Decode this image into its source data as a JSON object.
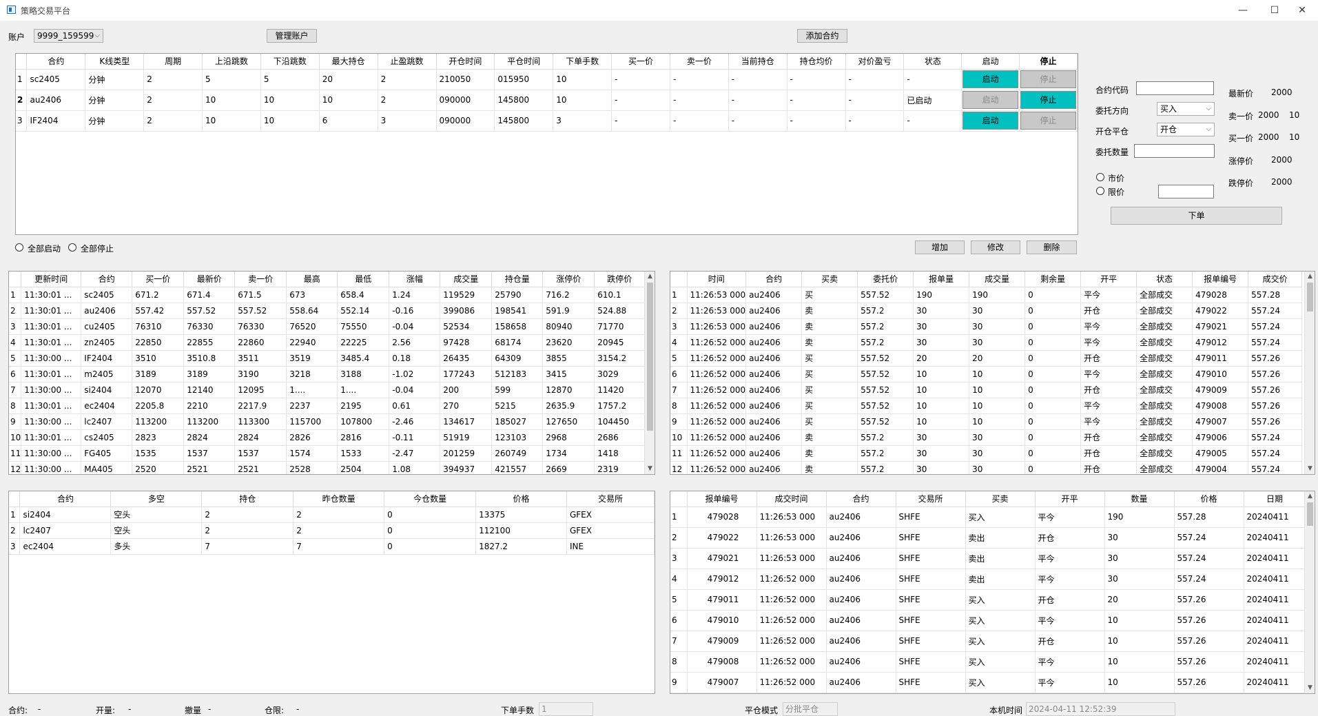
{
  "window": {
    "title": "策略交易平台",
    "min": "—",
    "max": "☐",
    "close": "✕"
  },
  "toolbar": {
    "account_label": "账户",
    "account_value": "9999_159599",
    "manage_btn": "管理账户",
    "add_contract_btn": "添加合约"
  },
  "strategy": {
    "headers": [
      "",
      "合约",
      "K线类型",
      "周期",
      "上沿跳数",
      "下沿跳数",
      "最大持仓",
      "止盈跳数",
      "开仓时间",
      "平仓时间",
      "下单手数",
      "买一价",
      "卖一价",
      "当前持仓",
      "持仓均价",
      "对价盈亏",
      "状态",
      "启动",
      "停止"
    ],
    "rows": [
      {
        "n": "1",
        "bold": false,
        "cells": [
          "sc2405",
          "分钟",
          "2",
          "5",
          "5",
          "20",
          "2",
          "210050",
          "015950",
          "10",
          "-",
          "-",
          "-",
          "-",
          "-",
          "-"
        ],
        "start": "启动",
        "stop": "停止",
        "start_on": true,
        "stop_on": false
      },
      {
        "n": "2",
        "bold": true,
        "cells": [
          "au2406",
          "分钟",
          "2",
          "10",
          "10",
          "10",
          "2",
          "090000",
          "145800",
          "10",
          "-",
          "-",
          "-",
          "-",
          "-",
          "已启动"
        ],
        "start": "启动",
        "stop": "停止",
        "start_on": false,
        "stop_on": true
      },
      {
        "n": "3",
        "bold": false,
        "cells": [
          "IF2404",
          "分钟",
          "2",
          "10",
          "10",
          "6",
          "3",
          "090000",
          "145800",
          "3",
          "-",
          "-",
          "-",
          "-",
          "-",
          "-"
        ],
        "start": "启动",
        "stop": "停止",
        "start_on": true,
        "stop_on": false
      }
    ],
    "all_start": "全部启动",
    "all_stop": "全部停止",
    "add_btn": "增加",
    "edit_btn": "修改",
    "delete_btn": "删除"
  },
  "order_form": {
    "code_label": "合约代码",
    "code_value": "",
    "direction_label": "委托方向",
    "direction_value": "买入",
    "offset_label": "开仓平仓",
    "offset_value": "开仓",
    "qty_label": "委托数量",
    "qty_value": "",
    "market_label": "市价",
    "limit_label": "限价",
    "limit_value": "",
    "submit_btn": "下单"
  },
  "quote_side": [
    {
      "label": "最新价",
      "value": "2000",
      "extra": ""
    },
    {
      "label": "卖一价",
      "value": "2000",
      "extra": "10"
    },
    {
      "label": "买一价",
      "value": "2000",
      "extra": "10"
    },
    {
      "label": "涨停价",
      "value": "2000",
      "extra": ""
    },
    {
      "label": "跌停价",
      "value": "2000",
      "extra": ""
    }
  ],
  "market": {
    "headers": [
      "",
      "更新时间",
      "合约",
      "买一价",
      "最新价",
      "卖一价",
      "最高",
      "最低",
      "涨幅",
      "成交量",
      "持仓量",
      "涨停价",
      "跌停价"
    ],
    "rows": [
      [
        "1",
        "11:30:01 ...",
        "sc2405",
        "671.2",
        "671.4",
        "671.5",
        "673",
        "658.4",
        "1.24",
        "119529",
        "25790",
        "716.2",
        "610.1"
      ],
      [
        "2",
        "11:30:01 ...",
        "au2406",
        "557.42",
        "557.52",
        "557.52",
        "558.64",
        "552.14",
        "-0.16",
        "399086",
        "198541",
        "591.9",
        "524.88"
      ],
      [
        "3",
        "11:30:01 ...",
        "cu2405",
        "76310",
        "76330",
        "76330",
        "76520",
        "75550",
        "-0.04",
        "52534",
        "158658",
        "80940",
        "71770"
      ],
      [
        "4",
        "11:30:01 ...",
        "zn2405",
        "22850",
        "22855",
        "22860",
        "22940",
        "22225",
        "2.56",
        "97428",
        "68174",
        "23620",
        "20945"
      ],
      [
        "5",
        "11:30:00 ...",
        "IF2404",
        "3510",
        "3510.8",
        "3511",
        "3519",
        "3485.4",
        "0.18",
        "26435",
        "64309",
        "3855",
        "3154.2"
      ],
      [
        "6",
        "11:30:01 ...",
        "m2405",
        "3189",
        "3189",
        "3190",
        "3218",
        "3188",
        "-1.02",
        "177243",
        "512183",
        "3415",
        "3029"
      ],
      [
        "7",
        "11:30:00 ...",
        "si2404",
        "12070",
        "12140",
        "12095",
        "1....",
        "1....",
        "-0.04",
        "200",
        "599",
        "12870",
        "11420"
      ],
      [
        "8",
        "11:30:01 ...",
        "ec2404",
        "2205.8",
        "2210",
        "2217.9",
        "2237",
        "2195",
        "0.61",
        "270",
        "5215",
        "2635.9",
        "1757.2"
      ],
      [
        "9",
        "11:30:00 ...",
        "lc2407",
        "113200",
        "113200",
        "113300",
        "115700",
        "107800",
        "-2.46",
        "134617",
        "185027",
        "127650",
        "104450"
      ],
      [
        "10",
        "11:30:01 ...",
        "cs2405",
        "2823",
        "2824",
        "2824",
        "2826",
        "2816",
        "-0.11",
        "51919",
        "123103",
        "2968",
        "2686"
      ],
      [
        "11",
        "11:30:00 ...",
        "FG405",
        "1535",
        "1537",
        "1537",
        "1574",
        "1533",
        "-2.47",
        "201259",
        "260749",
        "1734",
        "1418"
      ],
      [
        "12",
        "11:30:00 ...",
        "MA405",
        "2520",
        "2521",
        "2521",
        "2528",
        "2504",
        "1.08",
        "394937",
        "421557",
        "2669",
        "2319"
      ]
    ]
  },
  "orders": {
    "headers": [
      "",
      "时间",
      "合约",
      "买卖",
      "委托价",
      "报单量",
      "成交量",
      "剩余量",
      "开平",
      "状态",
      "报单编号",
      "成交价"
    ],
    "rows": [
      [
        "1",
        "11:26:53 000",
        "au2406",
        "买",
        "557.52",
        "190",
        "190",
        "0",
        "平今",
        "全部成交",
        "479028",
        "557.28"
      ],
      [
        "2",
        "11:26:53 000",
        "au2406",
        "卖",
        "557.2",
        "30",
        "30",
        "0",
        "开仓",
        "全部成交",
        "479022",
        "557.24"
      ],
      [
        "3",
        "11:26:53 000",
        "au2406",
        "卖",
        "557.2",
        "30",
        "30",
        "0",
        "平今",
        "全部成交",
        "479021",
        "557.24"
      ],
      [
        "4",
        "11:26:52 000",
        "au2406",
        "卖",
        "557.2",
        "30",
        "30",
        "0",
        "平今",
        "全部成交",
        "479012",
        "557.24"
      ],
      [
        "5",
        "11:26:52 000",
        "au2406",
        "买",
        "557.52",
        "20",
        "20",
        "0",
        "开仓",
        "全部成交",
        "479011",
        "557.26"
      ],
      [
        "6",
        "11:26:52 000",
        "au2406",
        "买",
        "557.52",
        "10",
        "10",
        "0",
        "平今",
        "全部成交",
        "479010",
        "557.26"
      ],
      [
        "7",
        "11:26:52 000",
        "au2406",
        "买",
        "557.52",
        "10",
        "10",
        "0",
        "开仓",
        "全部成交",
        "479009",
        "557.26"
      ],
      [
        "8",
        "11:26:52 000",
        "au2406",
        "买",
        "557.52",
        "10",
        "10",
        "0",
        "平今",
        "全部成交",
        "479008",
        "557.26"
      ],
      [
        "9",
        "11:26:52 000",
        "au2406",
        "买",
        "557.52",
        "10",
        "10",
        "0",
        "平今",
        "全部成交",
        "479007",
        "557.26"
      ],
      [
        "10",
        "11:26:52 000",
        "au2406",
        "卖",
        "557.2",
        "30",
        "30",
        "0",
        "开仓",
        "全部成交",
        "479006",
        "557.24"
      ],
      [
        "11",
        "11:26:52 000",
        "au2406",
        "卖",
        "557.2",
        "30",
        "30",
        "0",
        "开仓",
        "全部成交",
        "479005",
        "557.24"
      ],
      [
        "12",
        "11:26:52 000",
        "au2406",
        "卖",
        "557.2",
        "30",
        "30",
        "0",
        "开仓",
        "全部成交",
        "479004",
        "557.24"
      ]
    ]
  },
  "positions": {
    "headers": [
      "",
      "合约",
      "多空",
      "持仓",
      "昨仓数量",
      "今仓数量",
      "价格",
      "交易所"
    ],
    "rows": [
      [
        "1",
        "si2404",
        "空头",
        "2",
        "2",
        "0",
        "13375",
        "GFEX"
      ],
      [
        "2",
        "lc2407",
        "空头",
        "2",
        "2",
        "0",
        "112100",
        "GFEX"
      ],
      [
        "3",
        "ec2404",
        "多头",
        "7",
        "7",
        "0",
        "1827.2",
        "INE"
      ]
    ]
  },
  "trades": {
    "headers": [
      "",
      "报单编号",
      "成交时间",
      "合约",
      "交易所",
      "买卖",
      "开平",
      "数量",
      "价格",
      "日期"
    ],
    "rows": [
      [
        "1",
        "479028",
        "11:26:53 000",
        "au2406",
        "SHFE",
        "买入",
        "平今",
        "190",
        "557.28",
        "20240411"
      ],
      [
        "2",
        "479022",
        "11:26:53 000",
        "au2406",
        "SHFE",
        "卖出",
        "开仓",
        "30",
        "557.24",
        "20240411"
      ],
      [
        "3",
        "479021",
        "11:26:53 000",
        "au2406",
        "SHFE",
        "卖出",
        "平今",
        "30",
        "557.24",
        "20240411"
      ],
      [
        "4",
        "479012",
        "11:26:52 000",
        "au2406",
        "SHFE",
        "卖出",
        "平今",
        "30",
        "557.24",
        "20240411"
      ],
      [
        "5",
        "479011",
        "11:26:52 000",
        "au2406",
        "SHFE",
        "买入",
        "开仓",
        "20",
        "557.26",
        "20240411"
      ],
      [
        "6",
        "479010",
        "11:26:52 000",
        "au2406",
        "SHFE",
        "买入",
        "平今",
        "10",
        "557.26",
        "20240411"
      ],
      [
        "7",
        "479009",
        "11:26:52 000",
        "au2406",
        "SHFE",
        "买入",
        "开仓",
        "10",
        "557.26",
        "20240411"
      ],
      [
        "8",
        "479008",
        "11:26:52 000",
        "au2406",
        "SHFE",
        "买入",
        "平今",
        "10",
        "557.26",
        "20240411"
      ],
      [
        "9",
        "479007",
        "11:26:52 000",
        "au2406",
        "SHFE",
        "买入",
        "平今",
        "10",
        "557.26",
        "20240411"
      ]
    ]
  },
  "status_bar": {
    "contract_label": "合约:",
    "contract_value": "-",
    "open_label": "开量:",
    "open_value": "-",
    "cancel_label": "撤量",
    "cancel_value": "-",
    "limit_label": "仓限:",
    "limit_value": "-",
    "lots_label": "下单手数",
    "lots_value": "1",
    "close_mode_label": "平仓模式",
    "close_mode_value": "分批平仓",
    "local_time_label": "本机时间",
    "local_time_value": "2024-04-11 12:52:39"
  }
}
